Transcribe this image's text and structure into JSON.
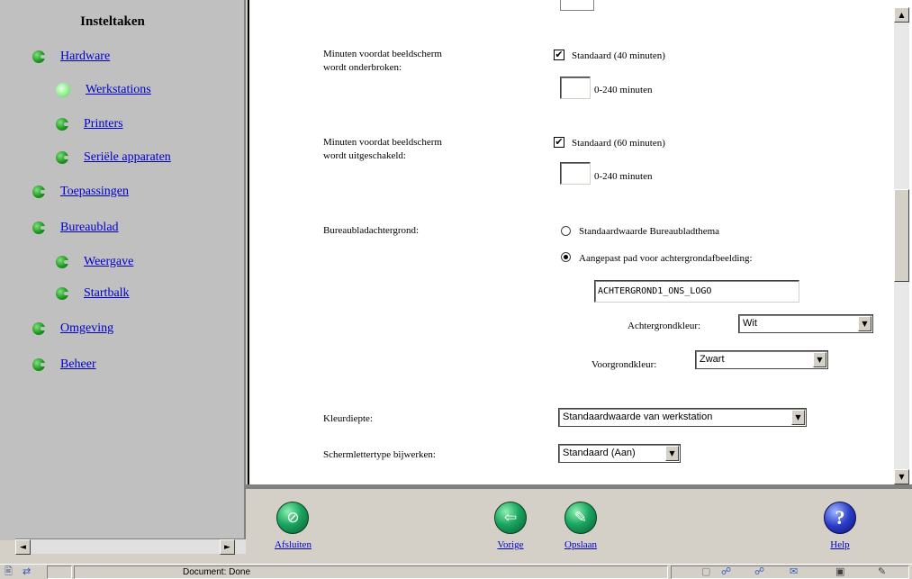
{
  "sidebar": {
    "title": "Insteltaken",
    "items": [
      {
        "label": "Hardware"
      },
      {
        "label": "Werkstations"
      },
      {
        "label": "Printers"
      },
      {
        "label": "Seriële apparaten"
      },
      {
        "label": "Toepassingen"
      },
      {
        "label": "Bureaublad"
      },
      {
        "label": "Weergave"
      },
      {
        "label": "Startbalk"
      },
      {
        "label": "Omgeving"
      },
      {
        "label": "Beheer"
      }
    ],
    "scroll_left": "◄",
    "scroll_right": "►"
  },
  "form": {
    "blank_label": {
      "line1": "Minuten voordat beeldscherm",
      "line2": "wordt onderbroken:",
      "checkbox_label": "Standaard (40 minuten)",
      "checked": true,
      "input_value": "",
      "range": "0-240 minuten"
    },
    "off_label": {
      "line1": "Minuten voordat beeldscherm",
      "line2": "wordt uitgeschakeld:",
      "checkbox_label": "Standaard (60 minuten)",
      "checked": true,
      "input_value": "",
      "range": "0-240 minuten"
    },
    "background": {
      "label": "Bureaubladachtergrond:",
      "option_default": "Standaardwaarde Bureaubladthema",
      "option_custom": "Aangepast pad voor achtergrondafbeelding:",
      "selected": "custom",
      "path_value": "ACHTERGROND1_ONS_LOGO",
      "bgcolor_label": "Achtergrondkleur:",
      "bgcolor_value": "Wit",
      "fgcolor_label": "Voorgrondkleur:",
      "fgcolor_value": "Zwart"
    },
    "color_depth": {
      "label": "Kleurdiepte:",
      "value": "Standaardwaarde van werkstation"
    },
    "font_update": {
      "label": "Schermlettertype bijwerken:",
      "value": "Standaard (Aan)"
    }
  },
  "checkmark": "✔",
  "dropdown_arrow": "▼",
  "scroll_up": "▲",
  "scroll_down": "▼",
  "toolbar": {
    "close": {
      "label": "Afsluiten",
      "icon": "close-icon",
      "glyph": "⊘"
    },
    "back": {
      "label": "Vorige",
      "icon": "back-arrow-icon",
      "glyph": "⇦"
    },
    "save": {
      "label": "Opslaan",
      "icon": "save-icon",
      "glyph": "✎"
    },
    "help": {
      "label": "Help",
      "icon": "help-icon",
      "glyph": "?"
    }
  },
  "statusbar": {
    "text": "Document: Done"
  },
  "colors": {
    "sidebar_bg": "#c0c0c0",
    "link": "#0000cc",
    "bullet_green": "#1f9a1f",
    "help_blue": "#2b3cc8"
  }
}
